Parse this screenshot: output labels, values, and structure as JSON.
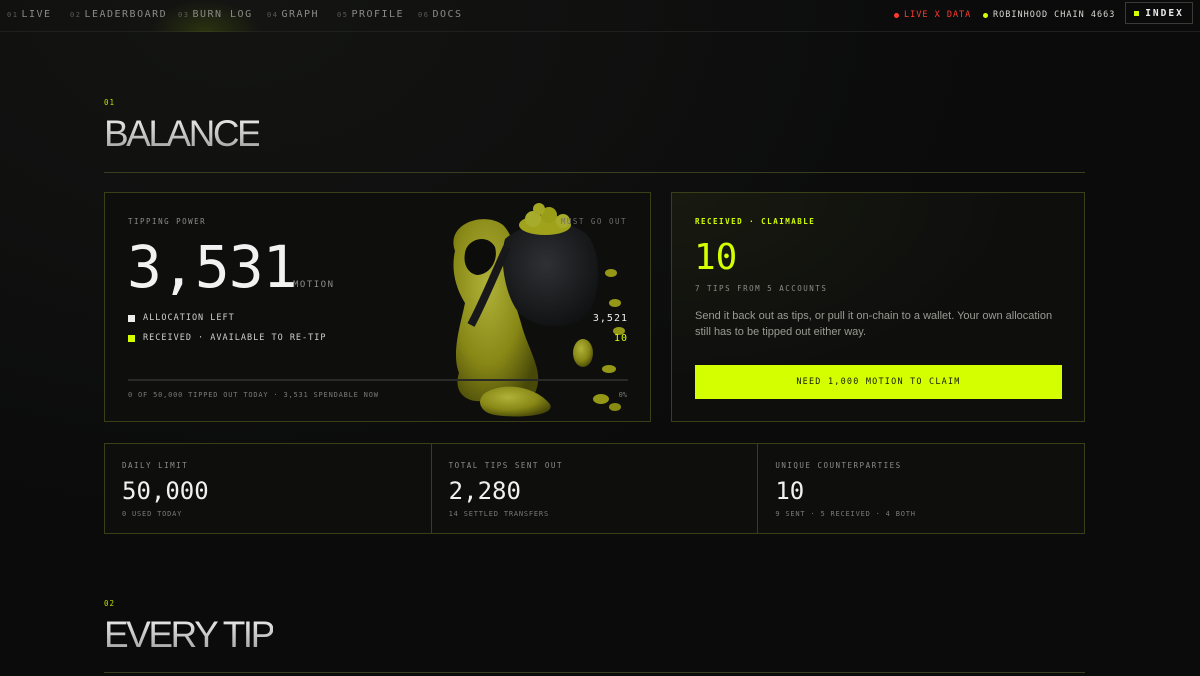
{
  "nav": {
    "items": [
      {
        "num": "01",
        "label": "LIVE"
      },
      {
        "num": "02",
        "label": "LEADERBOARD"
      },
      {
        "num": "03",
        "label": "BURN LOG"
      },
      {
        "num": "04",
        "label": "GRAPH"
      },
      {
        "num": "05",
        "label": "PROFILE"
      },
      {
        "num": "06",
        "label": "DOCS"
      }
    ],
    "live_status": "LIVE X DATA",
    "chain_status": "ROBINHOOD CHAIN 4663",
    "index_label": "INDEX"
  },
  "colors": {
    "accent": "#d4ff00",
    "live": "#ff3b2f",
    "background": "#0b0b0c",
    "border": "#3b3f18"
  },
  "balance": {
    "section_num": "01",
    "title": "BALANCE",
    "power": {
      "label": "TIPPING POWER",
      "tag": "MUST GO OUT",
      "value": "3,531",
      "unit": "MOTION",
      "rows": [
        {
          "label": "ALLOCATION LEFT",
          "value": "3,521"
        },
        {
          "label": "RECEIVED · AVAILABLE TO RE-TIP",
          "value": "10"
        }
      ],
      "progress_fraction": 0,
      "footer": "0 OF 50,000 TIPPED OUT TODAY · 3,531 SPENDABLE NOW",
      "percent": "0%"
    },
    "claim": {
      "label": "RECEIVED · CLAIMABLE",
      "value": "10",
      "sub": "7 TIPS FROM 5 ACCOUNTS",
      "description": "Send it back out as tips, or pull it on-chain to a wallet. Your own allocation still has to be tipped out either way.",
      "button": "NEED 1,000 MOTION TO CLAIM"
    },
    "stats": [
      {
        "label": "DAILY LIMIT",
        "value": "50,000",
        "sub": "0 USED TODAY"
      },
      {
        "label": "TOTAL TIPS SENT OUT",
        "value": "2,280",
        "sub": "14 SETTLED TRANSFERS"
      },
      {
        "label": "UNIQUE COUNTERPARTIES",
        "value": "10",
        "sub": "9 SENT · 5 RECEIVED · 4 BOTH"
      }
    ]
  },
  "every_tip": {
    "section_num": "02",
    "title": "EVERY TIP"
  }
}
